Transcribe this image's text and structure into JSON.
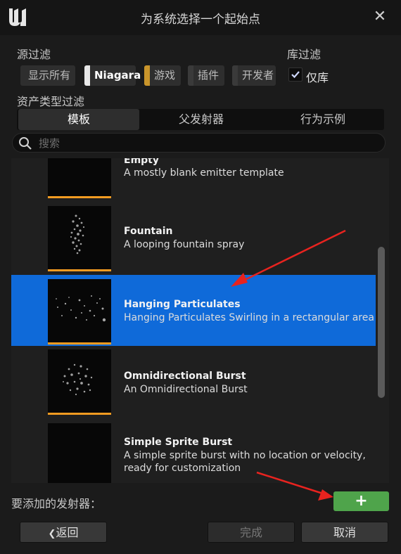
{
  "window": {
    "title": "为系统选择一个起始点",
    "close_glyph": "✕"
  },
  "source_filter": {
    "label": "源过滤",
    "chips": [
      {
        "label": "显示所有",
        "color": ""
      },
      {
        "label": "Niagara",
        "color": "#e8e8e8"
      },
      {
        "label": "游戏",
        "color": "#c9952b"
      },
      {
        "label": "插件",
        "color": "#3a3a3a"
      },
      {
        "label": "开发者",
        "color": "#3a3a3a"
      }
    ]
  },
  "library_filter": {
    "label": "库过滤",
    "checkbox_label": "仅库",
    "checked": true
  },
  "asset_type": {
    "label": "资产类型过滤",
    "tabs": [
      "模板",
      "父发射器",
      "行为示例"
    ],
    "selected": "模板"
  },
  "search": {
    "placeholder": "搜索",
    "value": ""
  },
  "emitters": [
    {
      "name": "Empty",
      "desc": "A mostly blank emitter template",
      "icon": "empty-thumbnail",
      "selected": false
    },
    {
      "name": "Fountain",
      "desc": "A looping fountain spray",
      "icon": "fountain-thumbnail",
      "selected": false
    },
    {
      "name": "Hanging Particulates",
      "desc": "Hanging Particulates Swirling in a rectangular area",
      "icon": "hanging-particulates-thumbnail",
      "selected": true
    },
    {
      "name": "Omnidirectional Burst",
      "desc": "An Omnidirectional Burst",
      "icon": "omnidirectional-burst-thumbnail",
      "selected": false
    },
    {
      "name": "Simple Sprite Burst",
      "desc": "A simple sprite burst with no location or velocity, ready for customization",
      "icon": "simple-sprite-burst-thumbnail",
      "selected": false
    }
  ],
  "footer": {
    "emitters_to_add_label": "要添加的发射器：",
    "add_glyph": "+",
    "back_label": "返回",
    "back_glyph": "❮",
    "finish_label": "完成",
    "cancel_label": "取消"
  },
  "colors": {
    "selection": "#0f6ad9",
    "accent_orange": "#f29b21",
    "add_button": "#4fa44b",
    "annotation_arrow": "#e8231f"
  }
}
